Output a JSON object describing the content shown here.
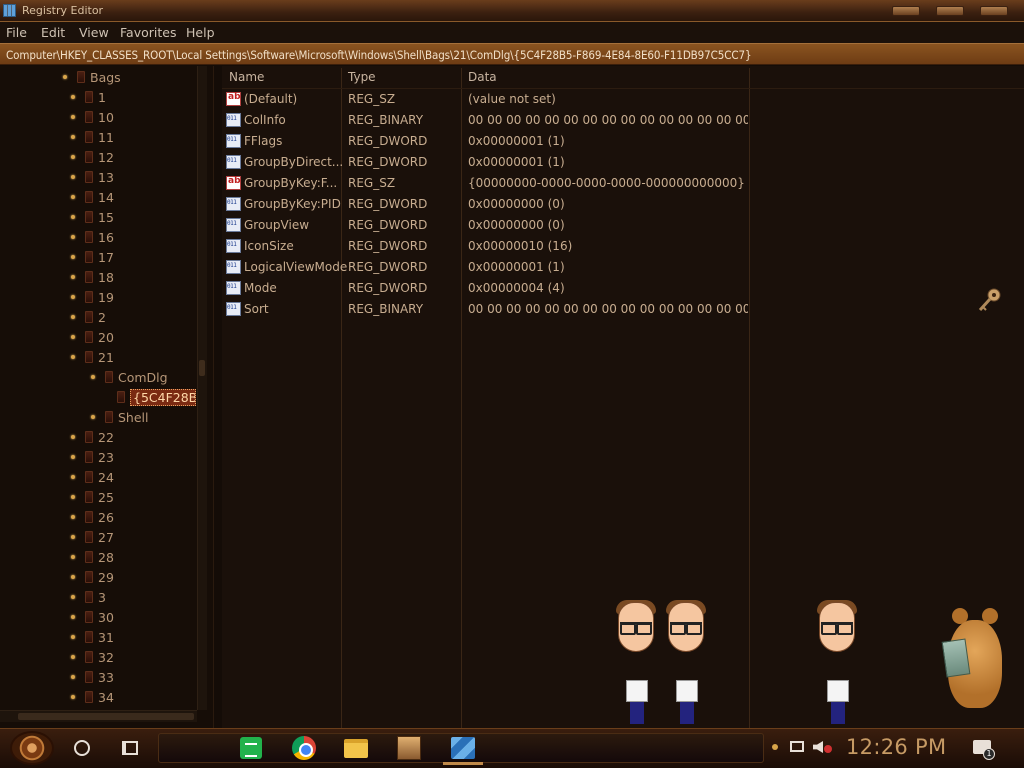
{
  "window": {
    "title": "Registry Editor"
  },
  "menu": [
    "File",
    "Edit",
    "View",
    "Favorites",
    "Help"
  ],
  "address": "Computer\\HKEY_CLASSES_ROOT\\Local Settings\\Software\\Microsoft\\Windows\\Shell\\Bags\\21\\ComDlg\\{5C4F28B5-F869-4E84-8E60-F11DB97C5CC7}",
  "tree": [
    {
      "label": "Bags",
      "depth": 0
    },
    {
      "label": "1",
      "depth": 1
    },
    {
      "label": "10",
      "depth": 1
    },
    {
      "label": "11",
      "depth": 1
    },
    {
      "label": "12",
      "depth": 1
    },
    {
      "label": "13",
      "depth": 1
    },
    {
      "label": "14",
      "depth": 1
    },
    {
      "label": "15",
      "depth": 1
    },
    {
      "label": "16",
      "depth": 1
    },
    {
      "label": "17",
      "depth": 1
    },
    {
      "label": "18",
      "depth": 1
    },
    {
      "label": "19",
      "depth": 1
    },
    {
      "label": "2",
      "depth": 1
    },
    {
      "label": "20",
      "depth": 1
    },
    {
      "label": "21",
      "depth": 1
    },
    {
      "label": "ComDlg",
      "depth": 2
    },
    {
      "label": "{5C4F28B5",
      "depth": 3,
      "selected": true
    },
    {
      "label": "Shell",
      "depth": 2
    },
    {
      "label": "22",
      "depth": 1
    },
    {
      "label": "23",
      "depth": 1
    },
    {
      "label": "24",
      "depth": 1
    },
    {
      "label": "25",
      "depth": 1
    },
    {
      "label": "26",
      "depth": 1
    },
    {
      "label": "27",
      "depth": 1
    },
    {
      "label": "28",
      "depth": 1
    },
    {
      "label": "29",
      "depth": 1
    },
    {
      "label": "3",
      "depth": 1
    },
    {
      "label": "30",
      "depth": 1
    },
    {
      "label": "31",
      "depth": 1
    },
    {
      "label": "32",
      "depth": 1
    },
    {
      "label": "33",
      "depth": 1
    },
    {
      "label": "34",
      "depth": 1
    }
  ],
  "columns": {
    "name": "Name",
    "type": "Type",
    "data": "Data"
  },
  "values": [
    {
      "name": "(Default)",
      "type": "REG_SZ",
      "data": "(value not set)",
      "icon": "string-value-icon"
    },
    {
      "name": "ColInfo",
      "type": "REG_BINARY",
      "data": "00 00 00 00 00 00 00 00 00 00 00 00 00 00 00 0...",
      "icon": "binary-value-icon"
    },
    {
      "name": "FFlags",
      "type": "REG_DWORD",
      "data": "0x00000001 (1)",
      "icon": "binary-value-icon"
    },
    {
      "name": "GroupByDirect...",
      "type": "REG_DWORD",
      "data": "0x00000001 (1)",
      "icon": "binary-value-icon"
    },
    {
      "name": "GroupByKey:F...",
      "type": "REG_SZ",
      "data": "{00000000-0000-0000-0000-000000000000}",
      "icon": "string-value-icon"
    },
    {
      "name": "GroupByKey:PID",
      "type": "REG_DWORD",
      "data": "0x00000000 (0)",
      "icon": "binary-value-icon"
    },
    {
      "name": "GroupView",
      "type": "REG_DWORD",
      "data": "0x00000000 (0)",
      "icon": "binary-value-icon"
    },
    {
      "name": "IconSize",
      "type": "REG_DWORD",
      "data": "0x00000010 (16)",
      "icon": "binary-value-icon"
    },
    {
      "name": "LogicalViewMode",
      "type": "REG_DWORD",
      "data": "0x00000001 (1)",
      "icon": "binary-value-icon"
    },
    {
      "name": "Mode",
      "type": "REG_DWORD",
      "data": "0x00000004 (4)",
      "icon": "binary-value-icon"
    },
    {
      "name": "Sort",
      "type": "REG_BINARY",
      "data": "00 00 00 00 00 00 00 00 00 00 00 00 00 00 00 0...",
      "icon": "binary-value-icon"
    }
  ],
  "taskbar": {
    "apps": [
      "sheets-icon",
      "chrome-icon",
      "file-explorer-icon",
      "game-icon",
      "regedit-icon"
    ],
    "clock": "12:26 PM",
    "notification_count": "1"
  }
}
